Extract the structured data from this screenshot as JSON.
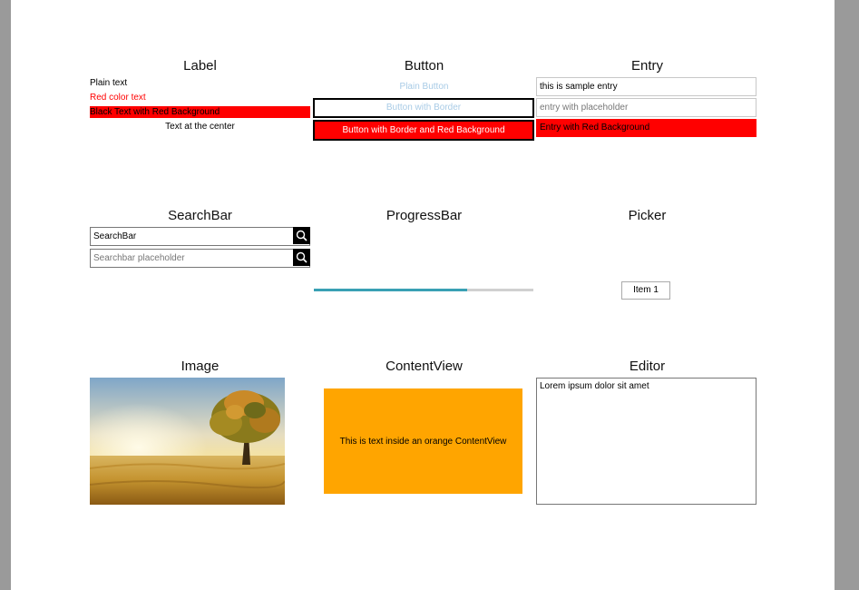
{
  "sections": {
    "label": {
      "title": "Label",
      "plain": "Plain text",
      "red_text": "Red color text",
      "red_bg_text": "Black Text with Red Background",
      "center_text": "Text at the center"
    },
    "button": {
      "title": "Button",
      "plain": "Plain Button",
      "with_border": "Button with Border",
      "with_border_red": "Button with Border and Red Background"
    },
    "entry": {
      "title": "Entry",
      "sample_value": "this is sample entry",
      "placeholder": "entry with placeholder",
      "red_value": "Entry with Red Background"
    },
    "searchbar": {
      "title": "SearchBar",
      "value": "SearchBar",
      "placeholder": "Searchbar placeholder"
    },
    "progressbar": {
      "title": "ProgressBar",
      "progress": 0.7
    },
    "picker": {
      "title": "Picker",
      "selected": "Item 1"
    },
    "image": {
      "title": "Image"
    },
    "contentview": {
      "title": "ContentView",
      "text": "This is text inside an orange ContentView"
    },
    "editor": {
      "title": "Editor",
      "value": "Lorem ipsum dolor sit amet"
    }
  },
  "icons": {
    "search": "search-icon"
  },
  "colors": {
    "red": "#ff0000",
    "orange": "#ffa500",
    "progress": "#39a0b4",
    "button_text": "#a8cbe6"
  }
}
